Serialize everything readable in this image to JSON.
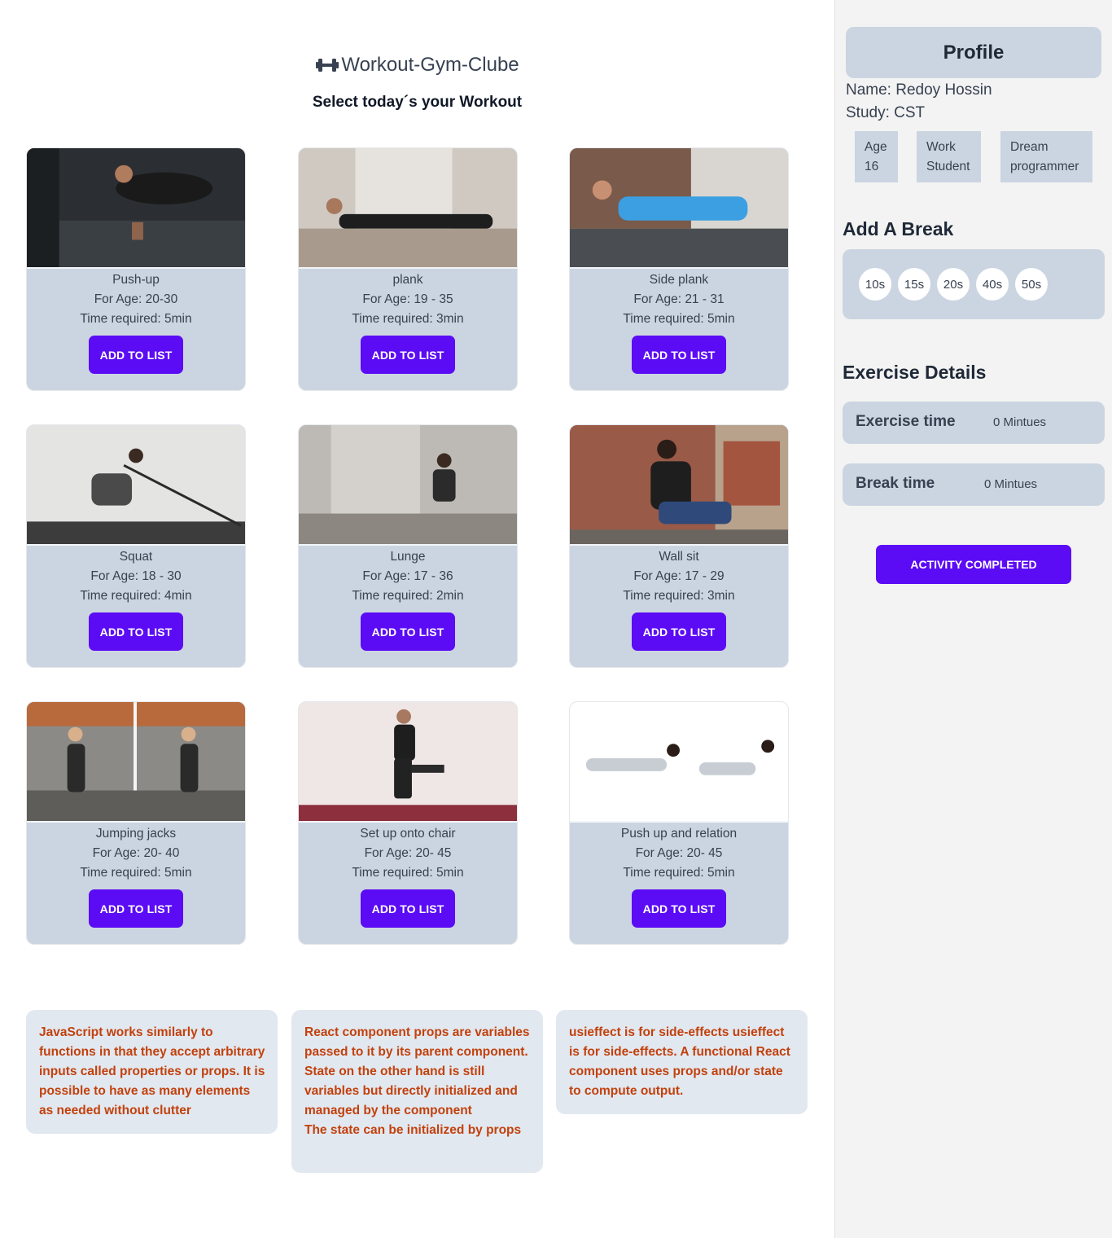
{
  "header": {
    "site_title": "Workout-Gym-Clube",
    "subtitle": "Select today´s your Workout",
    "logo_icon": "dumbbell-icon"
  },
  "exercises": [
    {
      "name": "Push-up",
      "age": "For Age: 20-30",
      "time": "Time required: 5min",
      "button": "ADD TO LIST"
    },
    {
      "name": "plank",
      "age": "For Age: 19 - 35",
      "time": "Time required: 3min",
      "button": "ADD TO LIST"
    },
    {
      "name": "Side plank",
      "age": "For Age: 21 - 31",
      "time": "Time required: 5min",
      "button": "ADD TO LIST"
    },
    {
      "name": "Squat",
      "age": "For Age: 18 - 30",
      "time": "Time required: 4min",
      "button": "ADD TO LIST"
    },
    {
      "name": "Lunge",
      "age": "For Age: 17 - 36",
      "time": "Time required: 2min",
      "button": "ADD TO LIST"
    },
    {
      "name": "Wall sit",
      "age": "For Age: 17 - 29",
      "time": "Time required: 3min",
      "button": "ADD TO LIST"
    },
    {
      "name": "Jumping jacks",
      "age": "For Age: 20- 40",
      "time": "Time required: 5min",
      "button": "ADD TO LIST"
    },
    {
      "name": "Set up onto chair",
      "age": "For Age: 20- 45",
      "time": "Time required: 5min",
      "button": "ADD TO LIST"
    },
    {
      "name": "Push up and relation",
      "age": "For Age: 20- 45",
      "time": "Time required: 5min",
      "button": "ADD TO LIST"
    }
  ],
  "qa": [
    {
      "text": "JavaScript works similarly to functions in that they accept arbitrary inputs called properties or props. It is possible to have as many elements as needed without clutter"
    },
    {
      "text": "React component props are variables passed to it by its parent component. State on the other hand is still variables but directly initialized and managed by the component",
      "extra": "The state can be initialized by props"
    },
    {
      "text": "usieffect is for side-effects usieffect is for side-effects. A functional React component uses props and/or state to compute output."
    }
  ],
  "profile": {
    "title": "Profile",
    "name": "Name: Redoy Hossin",
    "study": "Study: CST",
    "chips": [
      {
        "label": "Age",
        "value": "16"
      },
      {
        "label": "Work",
        "value": "Student"
      },
      {
        "label": "Dream",
        "value": "programmer"
      }
    ]
  },
  "break": {
    "title": "Add A Break",
    "options": [
      "10s",
      "15s",
      "20s",
      "40s",
      "50s"
    ]
  },
  "details": {
    "title": "Exercise Details",
    "exercise_label": "Exercise time",
    "exercise_value": "0 Mintues",
    "break_label": "Break time",
    "break_value": "0 Mintues"
  },
  "complete_button": "ACTIVITY COMPLETED",
  "colors": {
    "accent": "#5b0cf5",
    "card_bg": "#cbd5e1",
    "qa_text": "#c2410c",
    "sidebar_bg": "#f3f3f3"
  }
}
